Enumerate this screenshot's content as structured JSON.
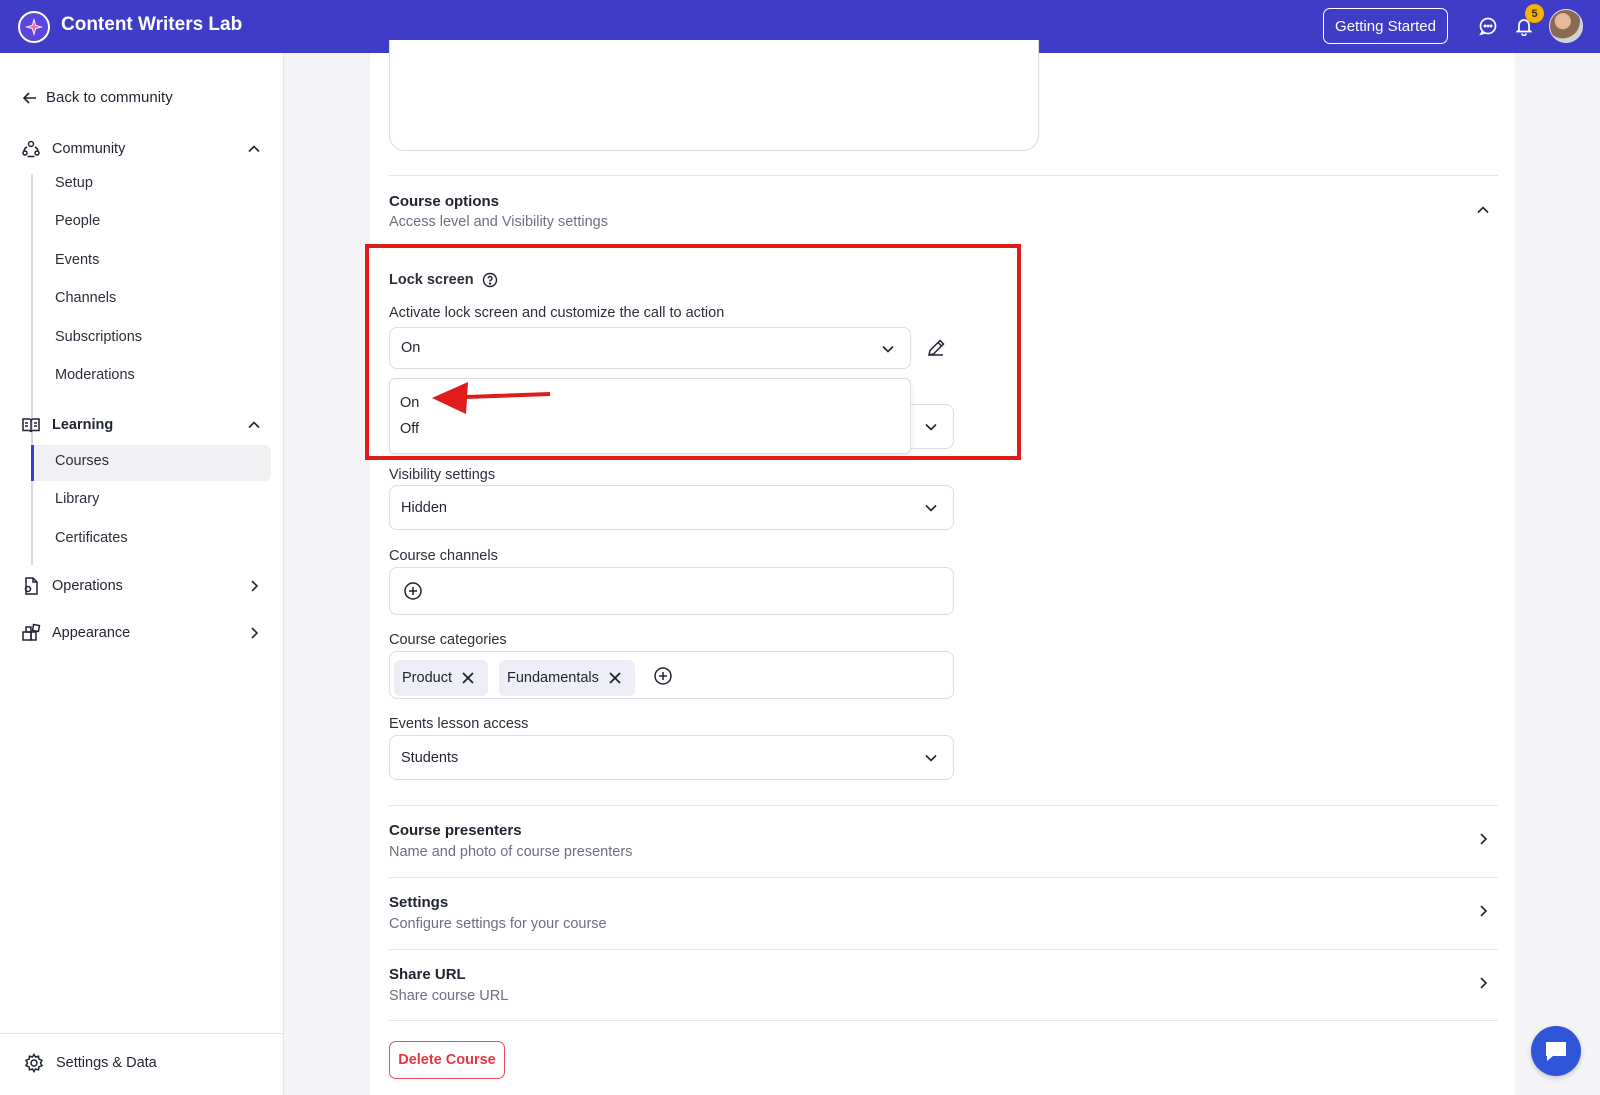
{
  "app": {
    "name": "Content Writers Lab"
  },
  "topbar": {
    "getting_started_label": "Getting Started",
    "notification_count": "5",
    "icons": [
      "brand-logo-icon",
      "chat-icon",
      "bell-icon",
      "avatar"
    ]
  },
  "sidebar": {
    "back_label": "Back to community",
    "community": {
      "label": "Community",
      "items": [
        "Setup",
        "People",
        "Events",
        "Channels",
        "Subscriptions",
        "Moderations"
      ]
    },
    "learning": {
      "label": "Learning",
      "items": [
        "Courses",
        "Library",
        "Certificates"
      ],
      "active": "Courses"
    },
    "operations_label": "Operations",
    "appearance_label": "Appearance",
    "settings_data_label": "Settings & Data"
  },
  "main": {
    "course_options": {
      "title": "Course options",
      "subtitle": "Access level and Visibility settings"
    },
    "lock_screen": {
      "label": "Lock screen",
      "description": "Activate lock screen and customize the call to action",
      "value": "On",
      "options": [
        "On",
        "Off"
      ]
    },
    "visibility": {
      "label": "Visibility settings",
      "value": "Hidden"
    },
    "course_channels": {
      "label": "Course channels"
    },
    "course_categories": {
      "label": "Course categories",
      "chips": [
        "Product",
        "Fundamentals"
      ]
    },
    "events_lesson_access": {
      "label": "Events lesson access",
      "value": "Students"
    },
    "sections": [
      {
        "title": "Course presenters",
        "subtitle": "Name and photo of course presenters"
      },
      {
        "title": "Settings",
        "subtitle": "Configure settings for your course"
      },
      {
        "title": "Share URL",
        "subtitle": "Share course URL"
      }
    ],
    "delete_label": "Delete Course"
  },
  "colors": {
    "topbar": "#3f3cc7",
    "highlight_box": "#e01b1b",
    "delete": "#e5363f",
    "chat_fab": "#2f55d8",
    "badge": "#f4b400"
  }
}
